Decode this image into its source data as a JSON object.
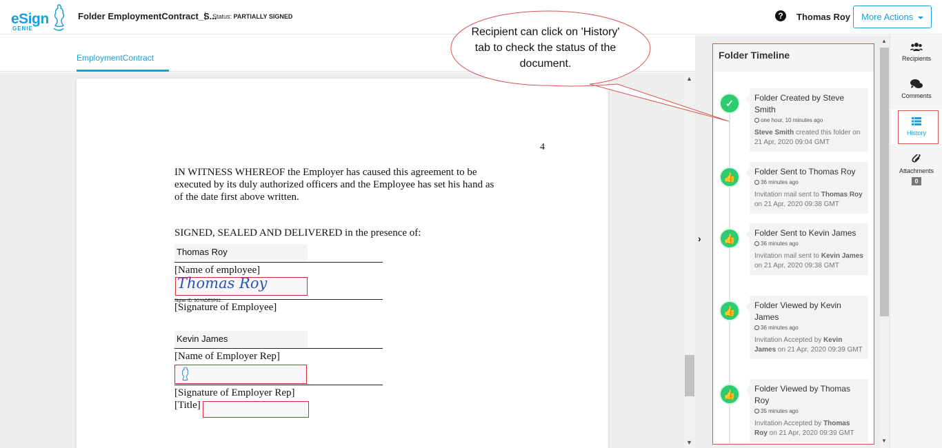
{
  "header": {
    "logo_text": "eSign",
    "logo_sub": "GENIE",
    "folder_title": "Folder EmploymentContract_S...",
    "separator": "|",
    "status_label": "Status:",
    "status_value": "PARTIALLY SIGNED",
    "help_icon": "question-circle-icon",
    "user_name": "Thomas Roy",
    "more_actions": "More Actions"
  },
  "tabs": [
    {
      "label": "EmploymentContract",
      "active": true
    }
  ],
  "document": {
    "page_number": "4",
    "witness_text": "IN WITNESS WHEREOF the Employer has caused this agreement to be executed by its duly authorized officers and the Employee has set his hand as of the date first above written.",
    "signed_text": "SIGNED, SEALED AND DELIVERED in the presence of:",
    "employee_name_value": "Thomas Roy",
    "employee_name_label": "[Name of employee]",
    "employee_signature": "Thomas Roy",
    "signer_id": "Signer ID: 9OYADESP82...",
    "employee_signature_label": "[Signature of Employee]",
    "employer_name_value": "Kevin James",
    "employer_name_label": "[Name of Employer Rep]",
    "employer_signature_label": "[Signature of Employer Rep]",
    "title_label": "[Title]"
  },
  "timeline": {
    "title": "Folder Timeline",
    "items": [
      {
        "icon": "check-icon",
        "title": "Folder Created by Steve Smith",
        "time": "one hour, 10 minutes ago",
        "detail_bold": "Steve Smith",
        "detail": " created this folder on 21 Apr, 2020 09:04 GMT"
      },
      {
        "icon": "thumbs-up-icon",
        "title": "Folder Sent to Thomas Roy",
        "time": "36 minutes ago",
        "detail_pre": "Invitation mail sent to ",
        "detail_bold": "Thomas Roy",
        "detail": " on 21 Apr, 2020 09:38 GMT"
      },
      {
        "icon": "thumbs-up-icon",
        "title": "Folder Sent to Kevin James",
        "time": "36 minutes ago",
        "detail_pre": "Invitation mail sent to ",
        "detail_bold": "Kevin James",
        "detail": " on 21 Apr, 2020 09:38 GMT"
      },
      {
        "icon": "thumbs-up-icon",
        "title": "Folder Viewed by Kevin James",
        "time": "36 minutes ago",
        "detail_pre": "Invitation Accepted by ",
        "detail_bold": "Kevin James",
        "detail": " on 21 Apr, 2020 09:39 GMT"
      },
      {
        "icon": "thumbs-up-icon",
        "title": "Folder Viewed by Thomas Roy",
        "time": "35 minutes ago",
        "detail_pre": "Invitation Accepted by ",
        "detail_bold": "Thomas Roy",
        "detail": " on 21 Apr, 2020 09:39 GMT"
      }
    ]
  },
  "rail": {
    "recipients": "Recipients",
    "comments": "Comments",
    "history": "History",
    "attachments": "Attachments",
    "attachments_count": "0"
  },
  "callout": {
    "text": "Recipient can click on 'History' tab to check the status of the document."
  },
  "colors": {
    "accent": "#1a9fd8",
    "success": "#2ecc71",
    "highlight_border": "#d9534f"
  }
}
